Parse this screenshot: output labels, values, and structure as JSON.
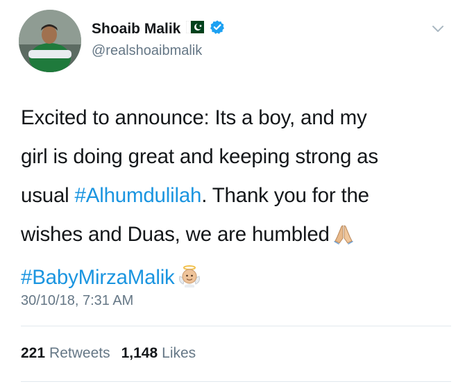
{
  "user": {
    "display_name": "Shoaib Malik",
    "handle": "@realshoaibmalik",
    "flag_icon": "pakistan-flag-icon",
    "verified_icon": "verified-badge-icon"
  },
  "tweet": {
    "line1": "Excited to announce: Its a boy, and my",
    "line2": "girl is doing great and keeping strong as",
    "line3_pre": "usual ",
    "hashtag_alhumdulilah": "#Alhumdulilah",
    "line3_post": ". Thank you for the",
    "line4": "wishes and Duas, we are humbled",
    "hashtag_baby": "#BabyMirzaMalik",
    "emoji_1": "folded-hands-emoji",
    "emoji_2": "baby-angel-emoji"
  },
  "timestamp": "30/10/18, 7:31 AM",
  "stats": {
    "retweets_count": "221",
    "retweets_label": "Retweets",
    "likes_count": "1,148",
    "likes_label": "Likes"
  },
  "colors": {
    "link": "#1b95e0",
    "secondary": "#657786",
    "primary_text": "#14171a",
    "verified": "#1da1f2",
    "flag_green": "#01411c",
    "divider": "#e1e8ed"
  }
}
